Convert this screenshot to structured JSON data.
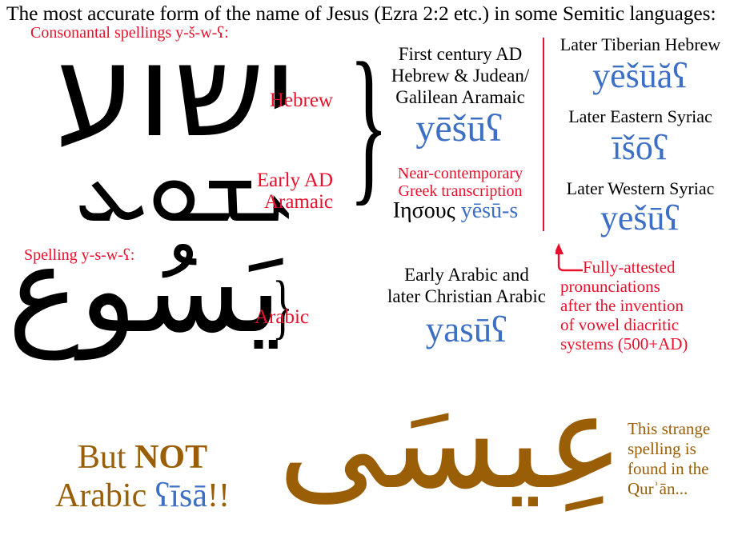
{
  "title": "The most accurate form of the name of Jesus (Ezra 2:2 etc.) in some Semitic languages:",
  "captions": {
    "consonantal": "Consonantal spellings y-š-w-ʕ:",
    "spelling": "Spelling y-s-w-ʕ:"
  },
  "scripts": {
    "hebrew_word": "ישוע",
    "syriac_word": "ܝܫܘܥ",
    "arabic_word": "يَسُوع",
    "quran_word": "عِيسَى"
  },
  "labels": {
    "hebrew": "Hebrew",
    "early_aramaic_line1": "Early AD",
    "early_aramaic_line2": "Aramaic",
    "arabic": "Arabic"
  },
  "middle": {
    "desc_line1": "First century AD",
    "desc_line2": "Hebrew & Judean/",
    "desc_line3": "Galilean Aramaic",
    "form": "yēšūʕ",
    "greek_caption_line1": "Near-contemporary",
    "greek_caption_line2": "Greek transcription",
    "greek_word": "Ιησους",
    "greek_translit": "yēsū-s",
    "arabic_desc_line1": "Early Arabic and",
    "arabic_desc_line2": "later Christian Arabic",
    "arabic_form": "yasūʕ"
  },
  "right_column": {
    "rows": [
      {
        "heading": "Later Tiberian Hebrew",
        "form": "yēšūăʕ"
      },
      {
        "heading": "Later Eastern Syriac",
        "form": "īšōʕ"
      },
      {
        "heading": "Later Western Syriac",
        "form": "yešūʕ"
      }
    ],
    "note_line1": "Fully-attested",
    "note_line2": "pronunciations",
    "note_line3": "after the invention",
    "note_line4": "of  vowel diacritic",
    "note_line5": "systems (500+AD)"
  },
  "bottom": {
    "but": "But ",
    "not": "NOT",
    "arabic_word_label": "Arabic ",
    "isa": "ʕīsā",
    "bangs": "!!",
    "quran_note_line1": "This strange",
    "quran_note_line2": "spelling is",
    "quran_note_line3": "found in the",
    "quran_note_line4": "Qurʾān..."
  },
  "colors": {
    "red": "#e8112d",
    "blue": "#3d6fc4",
    "brown": "#9a5e06",
    "black": "#000000",
    "background": "#ffffff"
  }
}
